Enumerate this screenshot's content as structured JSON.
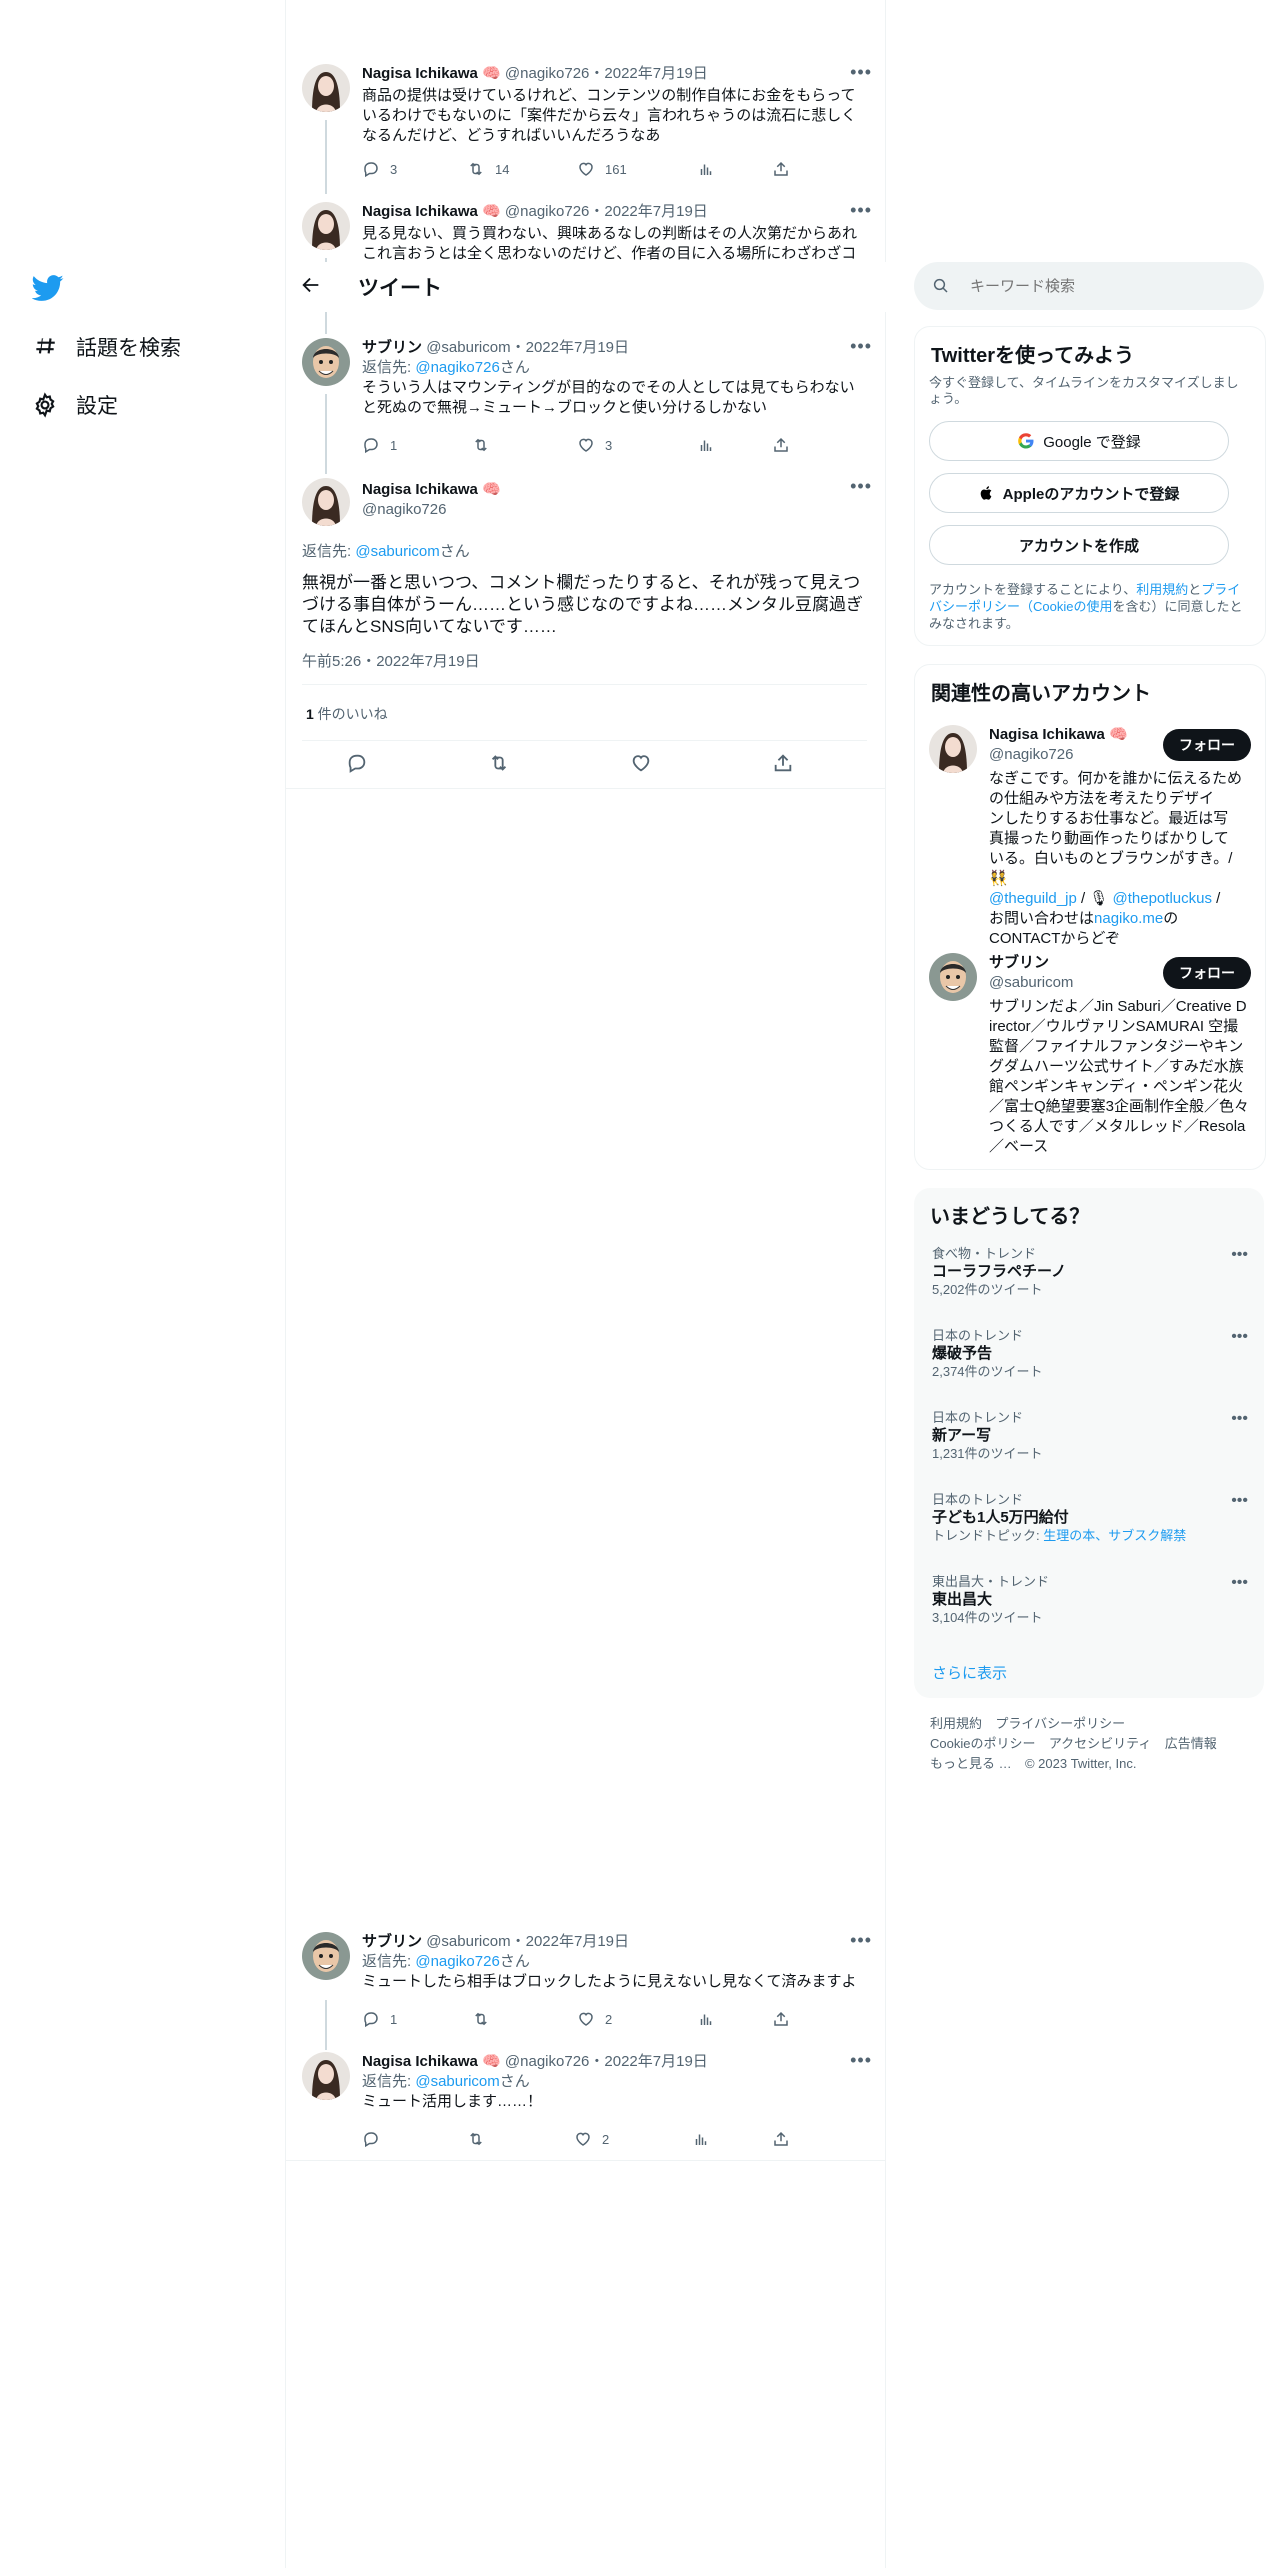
{
  "nav": {
    "explore_label": "話題を検索",
    "settings_label": "設定"
  },
  "header": {
    "title": "ツイート"
  },
  "thread_top": [
    {
      "name": "Nagisa Ichikawa 🧠",
      "handle": "@nagiko726",
      "date": "2022年7月19日",
      "text": "商品の提供は受けているけれど、コンテンツの制作自体にお金をもらっているわけでもないのに「案件だから云々」言われちゃうのは流石に悲しくなるんだけど、どうすればいいんだろうなあ",
      "replies": "3",
      "retweets": "14",
      "likes": "161"
    },
    {
      "name": "Nagisa Ichikawa 🧠",
      "handle": "@nagiko726",
      "date": "2022年7月19日",
      "text": "見る見ない、買う買わない、興味あるなしの判断はその人次第だからあれこれ言おうとは全く思わないのだけど、作者の目に入る場所にわざわざコ"
    },
    {
      "name": "サブリン",
      "handle": "@saburicom",
      "date": "2022年7月19日",
      "reply_prefix": "返信先: ",
      "reply_handle": "@nagiko726",
      "reply_suffix": "さん",
      "text": "そういう人はマウンティングが目的なのでその人としては見てもらわないと死ぬので無視→ミュート→ブロックと使い分けるしかない",
      "replies": "1",
      "retweets": "",
      "likes": "3"
    }
  ],
  "main_tweet": {
    "name": "Nagisa Ichikawa 🧠",
    "handle": "@nagiko726",
    "reply_prefix": "返信先: ",
    "reply_handle": "@saburicom",
    "reply_suffix": "さん",
    "text": "無視が一番と思いつつ、コメント欄だったりすると、それが残って見えつづける事自体がうーん……という感じなのですよね……メンタル豆腐過ぎてほんとSNS向いてないです……",
    "timestamp": "午前5:26・2022年7月19日",
    "likes_count": "1",
    "likes_label": " 件のいいね"
  },
  "replies_bottom": [
    {
      "name": "サブリン",
      "handle": "@saburicom",
      "date": "2022年7月19日",
      "reply_prefix": "返信先: ",
      "reply_handle": "@nagiko726",
      "reply_suffix": "さん",
      "text": "ミュートしたら相手はブロックしたように見えないし見なくて済みますよ",
      "replies": "1",
      "retweets": "",
      "likes": "2"
    },
    {
      "name": "Nagisa Ichikawa 🧠",
      "handle": "@nagiko726",
      "date": "2022年7月19日",
      "reply_prefix": "返信先: ",
      "reply_handle": "@saburicom",
      "reply_suffix": "さん",
      "text": "ミュート活用します……！",
      "replies": "",
      "retweets": "",
      "likes": "2"
    }
  ],
  "search": {
    "placeholder": "キーワード検索"
  },
  "signup": {
    "title": "Twitterを使ってみよう",
    "subtitle": "今すぐ登録して、タイムラインをカスタマイズしましょう。",
    "google_label": "Google で登録",
    "apple_label": "Appleのアカウントで登録",
    "create_label": "アカウントを作成",
    "legal_prefix": "アカウントを登録することにより、",
    "legal_terms": "利用規約",
    "legal_and": "と",
    "legal_privacy": "プライバシーポリシー（Cookieの使用",
    "legal_suffix": "を含む）に同意したとみなされます。"
  },
  "relevant": {
    "title": "関連性の高いアカウント",
    "accounts": [
      {
        "name": "Nagisa Ichikawa 🧠",
        "handle": "@nagiko726",
        "follow_label": "フォロー",
        "bio_lines": [
          "なぎこです。何かを誰かに伝えるため",
          "の仕組みや方法を考えたりデザイ",
          "ンしたりするお仕事など。最近は写",
          "真撮ったり動画作ったりばかりして",
          "いる。白いものとブラウンがすき。/ 👯"
        ],
        "bio_link1": "@theguild_jp",
        "bio_mid": " / 🎙 ",
        "bio_link2": "@thepotluckus",
        "bio_tail1": " /",
        "bio_contact_prefix": "お問い合わせは",
        "bio_contact_link": "nagiko.me",
        "bio_contact_suffix": "の",
        "bio_last": "CONTACTからどぞ"
      },
      {
        "name": "サブリン",
        "handle": "@saburicom",
        "follow_label": "フォロー",
        "bio": "サブリンだよ／Jin Saburi／Creative Director／ウルヴァリンSAMURAI 空撮監督／ファイナルファンタジーやキングダムハーツ公式サイト／すみだ水族館ペンギンキャンディ・ペンギン花火／富士Q絶望要塞3企画制作全般／色々つくる人です／メタルレッド／Resola／ベース"
      }
    ]
  },
  "trends": {
    "title": "いまどうしてる？",
    "items": [
      {
        "category": "食べ物・トレンド",
        "name": "コーラフラペチーノ",
        "count": "5,202件のツイート"
      },
      {
        "category": "日本のトレンド",
        "name": "爆破予告",
        "count": "2,374件のツイート"
      },
      {
        "category": "日本のトレンド",
        "name": "新アー写",
        "count": "1,231件のツイート"
      },
      {
        "category": "日本のトレンド",
        "name": "子ども1人5万円給付",
        "count_prefix": "トレンドトピック: ",
        "count_links": "生理の本、サブスク解禁"
      },
      {
        "category": "東出昌大・トレンド",
        "name": "東出昌大",
        "count": "3,104件のツイート"
      }
    ],
    "show_more": "さらに表示"
  },
  "footer": {
    "terms": "利用規約",
    "privacy": "プライバシーポリシー",
    "cookie": "Cookieのポリシー",
    "accessibility": "アクセシビリティ",
    "ads": "広告情報",
    "more": "もっと見る …",
    "copyright": "© 2023 Twitter, Inc."
  }
}
